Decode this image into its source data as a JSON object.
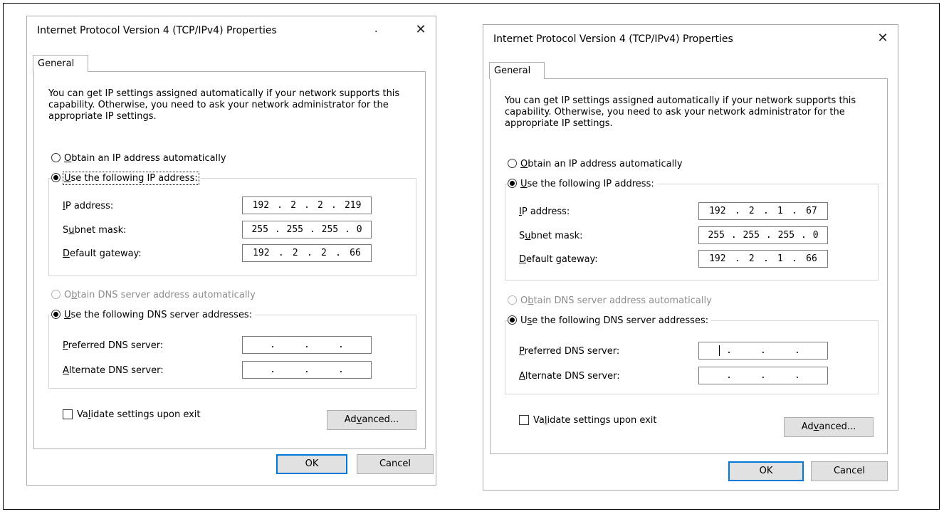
{
  "dialogs": [
    {
      "title": "Internet Protocol Version 4 (TCP/IPv4) Properties",
      "title_dot": ".",
      "close_glyph": "✕",
      "tab_label": "General",
      "description": "You can get IP settings assigned automatically if your network supports this capability. Otherwise, you need to ask your network administrator for the appropriate IP settings.",
      "ip_auto": {
        "label_pre": "",
        "accel": "O",
        "label_post": "btain an IP address automatically",
        "selected": false
      },
      "ip_manual": {
        "label_pre": "",
        "accel": "U",
        "label_post": "se the following IP address:",
        "selected": true
      },
      "ip_address": {
        "label_pre": "",
        "accel": "I",
        "label_post": "P address:",
        "octets": [
          "192",
          "2",
          "2",
          "219"
        ]
      },
      "subnet_mask": {
        "label_pre": "S",
        "accel": "u",
        "label_post": "bnet mask:",
        "octets": [
          "255",
          "255",
          "255",
          "0"
        ]
      },
      "default_gateway": {
        "label_pre": "",
        "accel": "D",
        "label_post": "efault gateway:",
        "octets": [
          "192",
          "2",
          "2",
          "66"
        ]
      },
      "dns_auto": {
        "label_pre": "O",
        "accel": "b",
        "label_post": "tain DNS server address automatically",
        "selected": false,
        "disabled": true
      },
      "dns_manual": {
        "label_pre": "",
        "accel": "U",
        "label_post": "se the following DNS server addresses:",
        "selected": true
      },
      "preferred_dns": {
        "label_pre": "",
        "accel": "P",
        "label_post": "referred DNS server:",
        "octets": [
          "",
          "",
          "",
          ""
        ]
      },
      "alternate_dns": {
        "label_pre": "",
        "accel": "A",
        "label_post": "lternate DNS server:",
        "octets": [
          "",
          "",
          "",
          ""
        ]
      },
      "validate": {
        "label_pre": "Va",
        "accel": "l",
        "label_post": "idate settings upon exit",
        "checked": false
      },
      "advanced": {
        "label_pre": "Ad",
        "accel": "v",
        "label_post": "anced..."
      },
      "ok_label": "OK",
      "cancel_label": "Cancel"
    },
    {
      "title": "Internet Protocol Version 4 (TCP/IPv4) Properties",
      "title_dot": "",
      "close_glyph": "✕",
      "tab_label": "General",
      "description": "You can get IP settings assigned automatically if your network supports this capability. Otherwise, you need to ask your network administrator for the appropriate IP settings.",
      "ip_auto": {
        "label_pre": "",
        "accel": "O",
        "label_post": "btain an IP address automatically",
        "selected": false
      },
      "ip_manual": {
        "label_pre": "",
        "accel": "U",
        "label_post": "se the following IP address:",
        "selected": true
      },
      "ip_address": {
        "label_pre": "",
        "accel": "I",
        "label_post": "P address:",
        "octets": [
          "192",
          "2",
          "1",
          "67"
        ]
      },
      "subnet_mask": {
        "label_pre": "S",
        "accel": "u",
        "label_post": "bnet mask:",
        "octets": [
          "255",
          "255",
          "255",
          "0"
        ]
      },
      "default_gateway": {
        "label_pre": "",
        "accel": "D",
        "label_post": "efault gateway:",
        "octets": [
          "192",
          "2",
          "1",
          "66"
        ]
      },
      "dns_auto": {
        "label_pre": "O",
        "accel": "b",
        "label_post": "tain DNS server address automatically",
        "selected": false,
        "disabled": true
      },
      "dns_manual": {
        "label_pre": "U",
        "accel": "s",
        "label_post": "e the following DNS server addresses:",
        "selected": true
      },
      "preferred_dns": {
        "label_pre": "",
        "accel": "P",
        "label_post": "referred DNS server:",
        "octets": [
          "",
          "",
          "",
          ""
        ]
      },
      "alternate_dns": {
        "label_pre": "",
        "accel": "A",
        "label_post": "lternate DNS server:",
        "octets": [
          "",
          "",
          "",
          ""
        ]
      },
      "validate": {
        "label_pre": "Va",
        "accel": "l",
        "label_post": "idate settings upon exit",
        "checked": false
      },
      "advanced": {
        "label_pre": "Ad",
        "accel": "v",
        "label_post": "anced..."
      },
      "ok_label": "OK",
      "cancel_label": "Cancel"
    }
  ]
}
